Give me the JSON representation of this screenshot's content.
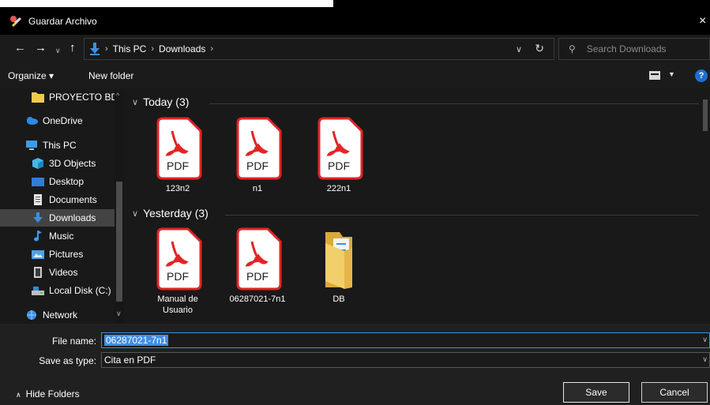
{
  "window": {
    "title": "Guardar Archivo",
    "close_glyph": "×"
  },
  "address": {
    "crumbs": [
      "This PC",
      "Downloads"
    ],
    "search_placeholder": "Search Downloads"
  },
  "toolbar": {
    "organize": "Organize ▾",
    "new_folder": "New folder",
    "help": "?"
  },
  "sidebar": {
    "items": [
      {
        "label": "PROYECTO BD-P",
        "icon": "folder-icon"
      },
      {
        "label": "OneDrive",
        "icon": "cloud-icon"
      },
      {
        "label": "This PC",
        "icon": "computer-icon"
      },
      {
        "label": "3D Objects",
        "icon": "cube-icon"
      },
      {
        "label": "Desktop",
        "icon": "desktop-icon"
      },
      {
        "label": "Documents",
        "icon": "document-icon"
      },
      {
        "label": "Downloads",
        "icon": "download-icon",
        "selected": true
      },
      {
        "label": "Music",
        "icon": "music-icon"
      },
      {
        "label": "Pictures",
        "icon": "pictures-icon"
      },
      {
        "label": "Videos",
        "icon": "videos-icon"
      },
      {
        "label": "Local Disk (C:)",
        "icon": "disk-icon"
      },
      {
        "label": "Network",
        "icon": "network-icon"
      }
    ]
  },
  "content": {
    "groups": [
      {
        "header": "Today (3)",
        "files": [
          {
            "name": "123n2",
            "type": "pdf"
          },
          {
            "name": "n1",
            "type": "pdf"
          },
          {
            "name": "222n1",
            "type": "pdf"
          }
        ]
      },
      {
        "header": "Yesterday (3)",
        "files": [
          {
            "name": "Manual de Usuario",
            "type": "pdf"
          },
          {
            "name": "06287021-7n1",
            "type": "pdf"
          },
          {
            "name": "DB",
            "type": "folder"
          }
        ]
      }
    ],
    "pdf_badge": "PDF"
  },
  "form": {
    "file_name_label": "File name:",
    "file_name_value": "06287021-7n1",
    "save_type_label": "Save as type:",
    "save_type_value": "Cita en PDF"
  },
  "footer": {
    "hide_folders": "Hide Folders",
    "save": "Save",
    "cancel": "Cancel"
  },
  "colors": {
    "accent": "#3d8ee6",
    "pdf_red": "#e32424",
    "folder_yellow": "#f2c94c"
  }
}
